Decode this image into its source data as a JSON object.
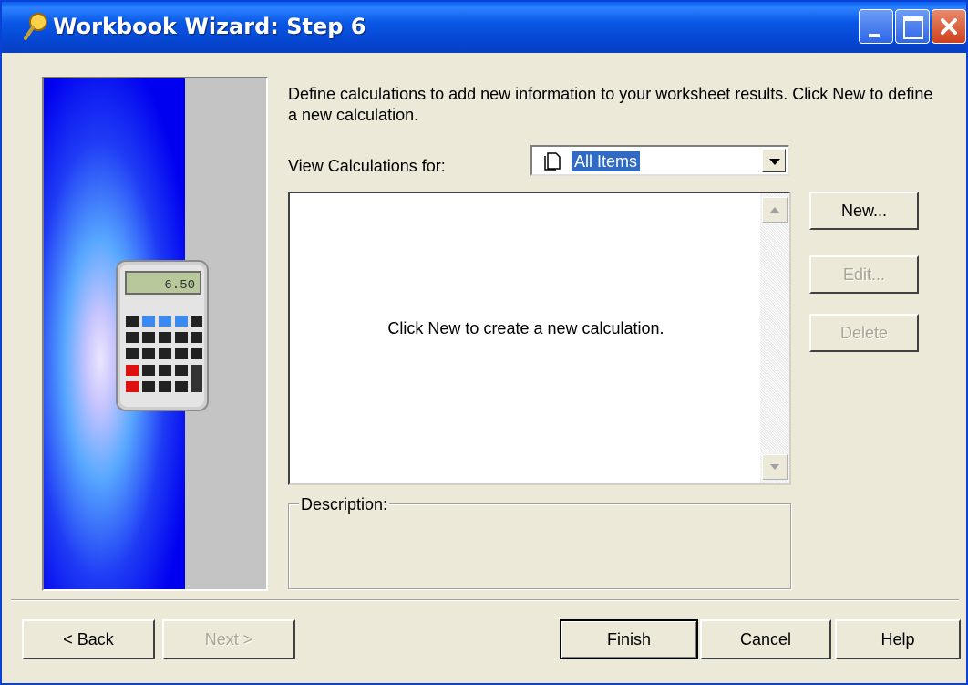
{
  "window": {
    "title": "Workbook Wizard: Step 6"
  },
  "main": {
    "instructions": "Define calculations to add new information to your worksheet results. Click New to define a new calculation.",
    "view_label": "View Calculations for:",
    "view_selected": "All Items",
    "list_empty_message": "Click New to create a new calculation.",
    "description_label": "Description:"
  },
  "side_buttons": {
    "new": "New...",
    "edit": "Edit...",
    "delete": "Delete"
  },
  "footer": {
    "back": "< Back",
    "next": "Next >",
    "finish": "Finish",
    "cancel": "Cancel",
    "help": "Help"
  },
  "colors": {
    "titlebar": "#0a58e6",
    "dialog_bg": "#ece9d8",
    "selection": "#316ac5",
    "disabled_text": "#a8a496"
  },
  "calculator_display": "6.50"
}
